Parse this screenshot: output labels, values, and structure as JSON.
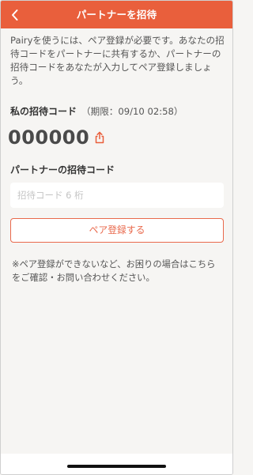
{
  "header": {
    "title": "パートナーを招待"
  },
  "description": "Pairyを使うには、ペア登録が必要です。あなたの招待コードをパートナーに共有するか、パートナーの招待コードをあなたが入力してペア登録しましょう。",
  "my_code": {
    "title": "私の招待コード",
    "expiry": "（期限：09/10 02:58）",
    "code": "000000",
    "share_icon": "share-icon"
  },
  "partner_code": {
    "title": "パートナーの招待コード",
    "value": "",
    "placeholder": "招待コード 6 桁"
  },
  "pair_button": {
    "label": "ペア登録する"
  },
  "note": "※ペア登録ができないなど、お困りの場合はこちらをご確認・お問い合わせください。",
  "colors": {
    "accent": "#e95f3c",
    "background": "#f6f5f3"
  }
}
